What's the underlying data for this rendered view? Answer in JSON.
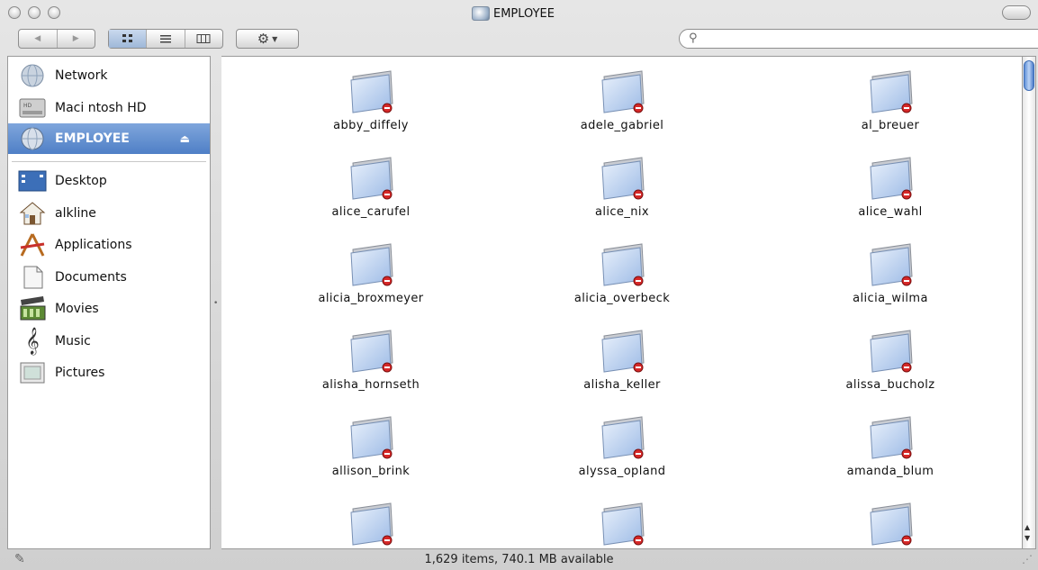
{
  "window": {
    "title": "EMPLOYEE"
  },
  "toolbar": {
    "nav": [
      "◀",
      "▶"
    ],
    "view_modes": [
      "icon-view",
      "list-view",
      "column-view"
    ],
    "action_menu": "action",
    "search_placeholder": ""
  },
  "sidebar": {
    "devices": [
      {
        "label": "Network",
        "icon": "network-globe-icon"
      },
      {
        "label": "Maci ntosh HD",
        "icon": "hard-drive-icon"
      },
      {
        "label": "EMPLOYEE",
        "icon": "network-volume-icon",
        "selected": true,
        "eject": "⏏"
      }
    ],
    "places": [
      {
        "label": "Desktop",
        "icon": "desktop-icon"
      },
      {
        "label": "alkline",
        "icon": "home-icon"
      },
      {
        "label": "Applications",
        "icon": "applications-icon"
      },
      {
        "label": "Documents",
        "icon": "documents-icon"
      },
      {
        "label": "Movies",
        "icon": "movies-icon"
      },
      {
        "label": "Music",
        "icon": "music-icon"
      },
      {
        "label": "Pictures",
        "icon": "pictures-icon"
      }
    ]
  },
  "folders": [
    "abby_diffely",
    "adele_gabriel",
    "al_breuer",
    "alice_carufel",
    "alice_nix",
    "alice_wahl",
    "alicia_broxmeyer",
    "alicia_overbeck",
    "alicia_wilma",
    "alisha_hornseth",
    "alisha_keller",
    "alissa_bucholz",
    "allison_brink",
    "alyssa_opland",
    "amanda_blum",
    "",
    "",
    ""
  ],
  "status": {
    "text": "1,629 items, 740.1 MB available"
  },
  "colors": {
    "selection": "#5b89cf",
    "no_access_badge": "#d62828",
    "folder_blue": "#a9c6ee"
  }
}
